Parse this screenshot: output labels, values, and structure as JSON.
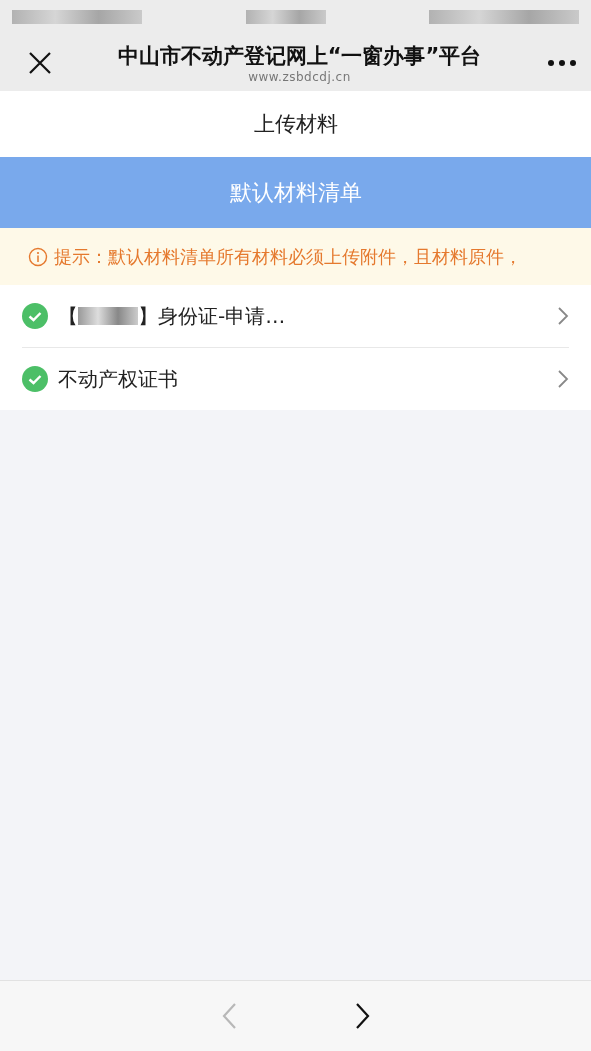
{
  "header": {
    "title": "中山市不动产登记网上“一窗办事”平台",
    "url": "www.zsbdcdj.cn"
  },
  "page_title": "上传材料",
  "section": "默认材料清单",
  "notice": {
    "label": "提示：",
    "text": "默认材料清单所有材料必须上传附件，且材料原件，"
  },
  "items": [
    {
      "prefix": "【",
      "redacted": true,
      "text": "】身份证-申请…",
      "done": true
    },
    {
      "text": "不动产权证书",
      "redacted": false,
      "done": true
    }
  ],
  "nav": [
    {
      "kind": "back",
      "disabled": true
    },
    {
      "kind": "forward",
      "disabled": false
    }
  ]
}
